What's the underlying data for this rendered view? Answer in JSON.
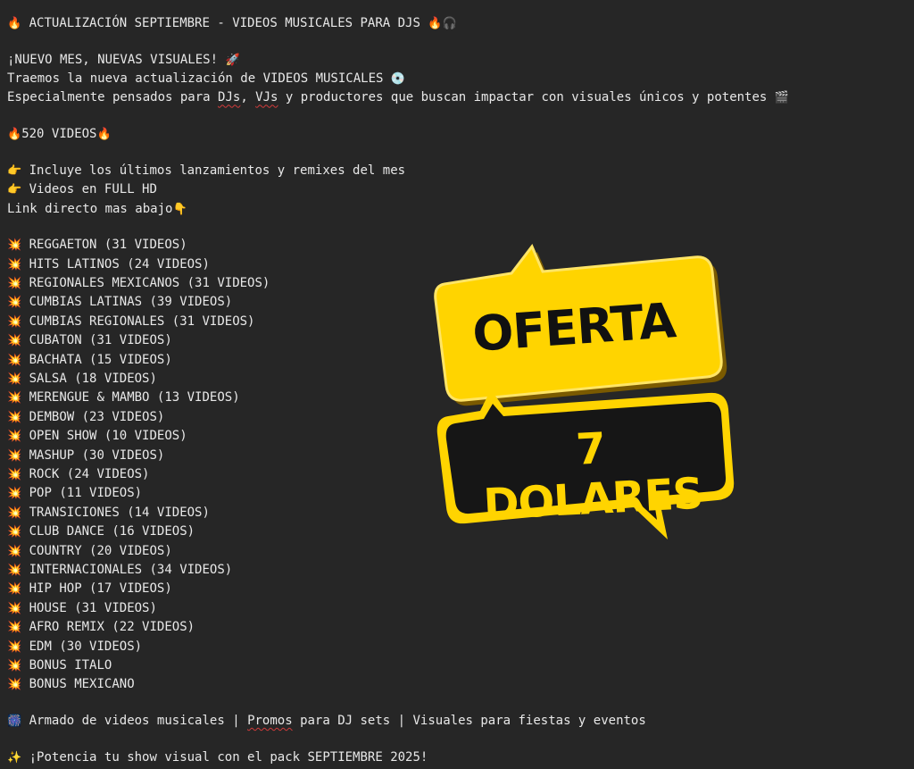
{
  "header": {
    "title": "ACTUALIZACIÓN SEPTIEMBRE - VIDEOS MUSICALES PARA DJS",
    "title_icon_left": "🔥",
    "title_icon_right": "🔥🎧"
  },
  "intro": {
    "line1": "¡NUEVO MES, NUEVAS VISUALES! ",
    "line1_icon": "🚀",
    "line2": "Traemos la nueva actualización de VIDEOS MUSICALES ",
    "line2_icon": "💿",
    "line3_pre": "Especialmente pensados para ",
    "line3_djs": "DJs",
    "line3_mid": ", ",
    "line3_vjs": "VJs",
    "line3_post": " y productores que buscan impactar con visuales únicos y potentes ",
    "line3_icon": "🎬"
  },
  "count": {
    "icon_left": "🔥",
    "text": "520 VIDEOS",
    "icon_right": "🔥"
  },
  "features": [
    {
      "icon": "👉",
      "text": " Incluye los últimos lanzamientos y remixes del mes"
    },
    {
      "icon": "👉",
      "text": " Videos en FULL HD"
    }
  ],
  "link_note": {
    "text": "Link directo mas abajo",
    "icon": "👇"
  },
  "categories_icon": "💥",
  "categories": [
    "REGGAETON (31 VIDEOS)",
    "HITS LATINOS (24 VIDEOS)",
    "REGIONALES MEXICANOS (31 VIDEOS)",
    "CUMBIAS LATINAS (39 VIDEOS)",
    "CUMBIAS REGIONALES (31 VIDEOS)",
    "CUBATON (31 VIDEOS)",
    "BACHATA (15 VIDEOS)",
    "SALSA (18 VIDEOS)",
    "MERENGUE & MAMBO (13 VIDEOS)",
    "DEMBOW (23 VIDEOS)",
    "OPEN SHOW (10 VIDEOS)",
    "MASHUP (30 VIDEOS)",
    "ROCK (24 VIDEOS)",
    "POP (11 VIDEOS)",
    "TRANSICIONES (14 VIDEOS)",
    "CLUB DANCE (16 VIDEOS)",
    "COUNTRY (20 VIDEOS)",
    "INTERNACIONALES (34 VIDEOS)",
    "HIP HOP (17 VIDEOS)",
    "HOUSE (31 VIDEOS)",
    "AFRO REMIX (22 VIDEOS)",
    "EDM (30 VIDEOS)",
    "BONUS ITALO",
    "BONUS MEXICANO"
  ],
  "footer": {
    "line1_icon": "🎆",
    "line1_pre": " Armado de videos musicales | ",
    "line1_promos": "Promos",
    "line1_post": " para DJ sets | Visuales para fiestas y eventos",
    "line2_icon": "✨",
    "line2_text": " ¡Potencia tu show visual con el pack SEPTIEMBRE 2025!"
  },
  "offer": {
    "label": "OFERTA",
    "price": "7 DOLARES",
    "colors": {
      "yellow": "#ffd400",
      "dark": "#161616"
    }
  }
}
